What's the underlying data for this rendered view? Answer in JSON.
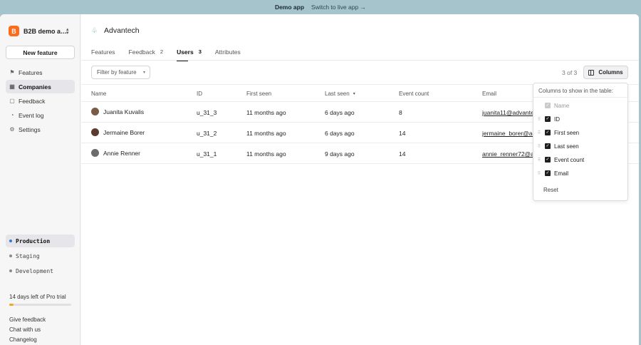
{
  "banner": {
    "mode": "Demo app",
    "switch_link": "Switch to live app →"
  },
  "sidebar": {
    "org_name": "B2B demo a…",
    "org_initial": "B",
    "new_feature": "New feature",
    "nav": [
      {
        "label": "Features",
        "icon": "flag-icon",
        "active": false
      },
      {
        "label": "Companies",
        "icon": "building-icon",
        "active": true
      },
      {
        "label": "Feedback",
        "icon": "chat-icon",
        "active": false
      },
      {
        "label": "Event log",
        "icon": "event-icon",
        "active": false
      },
      {
        "label": "Settings",
        "icon": "settings-icon",
        "active": false
      }
    ],
    "environments": [
      {
        "label": "Production",
        "active": true
      },
      {
        "label": "Staging",
        "active": false
      },
      {
        "label": "Development",
        "active": false
      }
    ],
    "trial_text": "14 days left of Pro trial",
    "trial_progress": 0.07,
    "footer_links": [
      "Give feedback",
      "Chat with us",
      "Changelog"
    ]
  },
  "main": {
    "company_name": "Advantech",
    "tabs": [
      {
        "label": "Features",
        "count": ""
      },
      {
        "label": "Feedback",
        "count": "2"
      },
      {
        "label": "Users",
        "count": "3",
        "active": true
      },
      {
        "label": "Attributes",
        "count": ""
      }
    ],
    "filter_label": "Filter by feature",
    "result_count": "3 of 3",
    "columns_button": "Columns",
    "table": {
      "headers": [
        "Name",
        "ID",
        "First seen",
        "Last seen",
        "Event count",
        "Email"
      ],
      "rows": [
        {
          "name": "Juanita Kuvalis",
          "id": "u_31_3",
          "first_seen": "11 months ago",
          "last_seen": "6 days ago",
          "event_count": "8",
          "email": "juanita11@advante"
        },
        {
          "name": "Jermaine Borer",
          "id": "u_31_2",
          "first_seen": "11 months ago",
          "last_seen": "6 days ago",
          "event_count": "14",
          "email": "jermaine_borer@ac"
        },
        {
          "name": "Annie Renner",
          "id": "u_31_1",
          "first_seen": "11 months ago",
          "last_seen": "9 days ago",
          "event_count": "14",
          "email": "annie_renner72@a"
        }
      ]
    },
    "columns_dropdown": {
      "title": "Columns to show in the table:",
      "items": [
        {
          "label": "Name",
          "checked": true,
          "disabled": true
        },
        {
          "label": "ID",
          "checked": true
        },
        {
          "label": "First seen",
          "checked": true
        },
        {
          "label": "Last seen",
          "checked": true
        },
        {
          "label": "Event count",
          "checked": true
        },
        {
          "label": "Email",
          "checked": true
        }
      ],
      "reset": "Reset"
    }
  }
}
